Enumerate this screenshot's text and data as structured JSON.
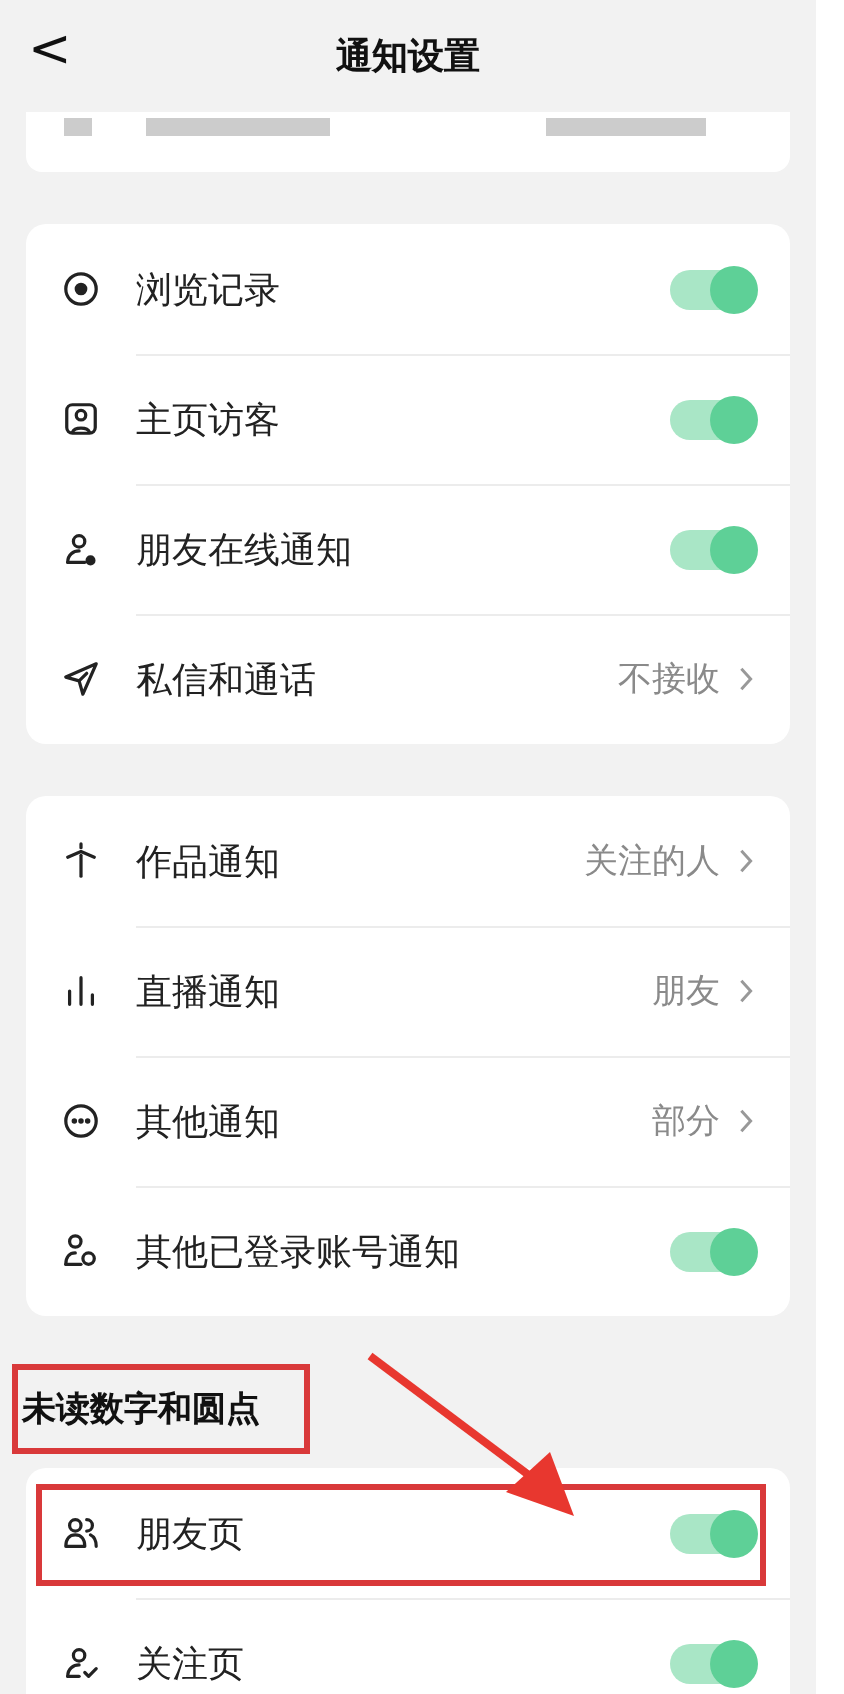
{
  "header": {
    "back": "<",
    "title": "通知设置"
  },
  "sections": [
    {
      "rows": [
        {
          "kind": "toggle",
          "label": "浏览记录",
          "on": true
        },
        {
          "kind": "toggle",
          "label": "主页访客",
          "on": true
        },
        {
          "kind": "toggle",
          "label": "朋友在线通知",
          "on": true
        },
        {
          "kind": "link",
          "label": "私信和通话",
          "value": "不接收"
        }
      ]
    },
    {
      "rows": [
        {
          "kind": "link",
          "label": "作品通知",
          "value": "关注的人"
        },
        {
          "kind": "link",
          "label": "直播通知",
          "value": "朋友"
        },
        {
          "kind": "link",
          "label": "其他通知",
          "value": "部分"
        },
        {
          "kind": "toggle",
          "label": "其他已登录账号通知",
          "on": true
        }
      ]
    },
    {
      "heading": "未读数字和圆点",
      "highlighted": true,
      "rows": [
        {
          "kind": "toggle",
          "label": "朋友页",
          "on": true,
          "highlighted": true
        },
        {
          "kind": "toggle",
          "label": "关注页",
          "on": true
        }
      ]
    }
  ]
}
